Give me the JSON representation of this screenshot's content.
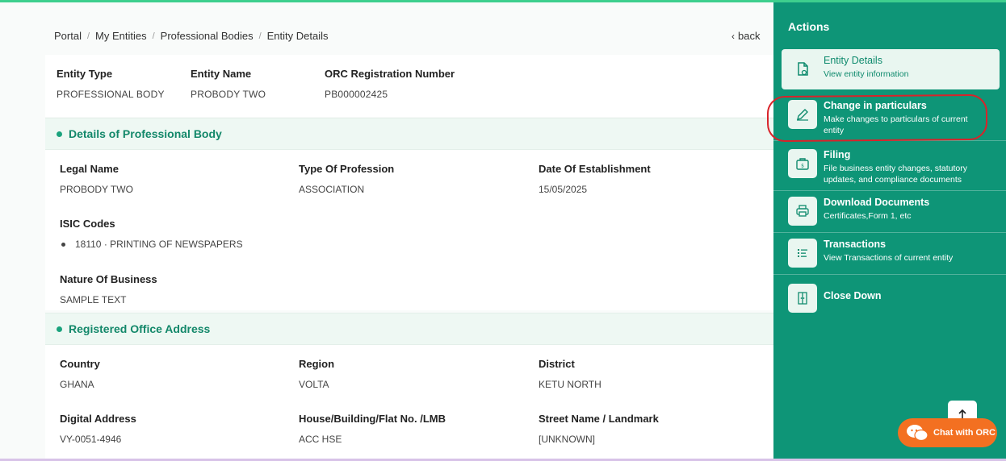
{
  "breadcrumb": [
    "Portal",
    "My Entities",
    "Professional Bodies",
    "Entity Details"
  ],
  "back_label": "back",
  "summary": [
    {
      "label": "Entity Type",
      "value": "PROFESSIONAL BODY"
    },
    {
      "label": "Entity Name",
      "value": "PROBODY TWO"
    },
    {
      "label": "ORC Registration Number",
      "value": "PB000002425"
    }
  ],
  "details_section": {
    "title": "Details of Professional Body",
    "legal_name": {
      "label": "Legal Name",
      "value": "PROBODY TWO"
    },
    "profession_type": {
      "label": "Type Of Profession",
      "value": "ASSOCIATION"
    },
    "establishment_date": {
      "label": "Date Of Establishment",
      "value": "15/05/2025"
    },
    "isic": {
      "label": "ISIC Codes",
      "items": [
        "18110 · PRINTING OF NEWSPAPERS"
      ]
    },
    "nature": {
      "label": "Nature Of Business",
      "value": "SAMPLE TEXT"
    }
  },
  "address_section": {
    "title": "Registered Office Address",
    "country": {
      "label": "Country",
      "value": "GHANA"
    },
    "region": {
      "label": "Region",
      "value": "VOLTA"
    },
    "district": {
      "label": "District",
      "value": "KETU NORTH"
    },
    "digital_address": {
      "label": "Digital Address",
      "value": "VY-0051-4946"
    },
    "house": {
      "label": "House/Building/Flat No. /LMB",
      "value": "ACC HSE"
    },
    "street": {
      "label": "Street Name / Landmark",
      "value": "[UNKNOWN]"
    }
  },
  "actions": {
    "title": "Actions",
    "items": [
      {
        "title": "Entity Details",
        "desc": "View entity information",
        "icon": "file-eye-icon"
      },
      {
        "title": "Change in particulars",
        "desc": "Make changes to particulars of current entity",
        "icon": "pencil-icon"
      },
      {
        "title": "Filing",
        "desc": "File business entity changes, statutory updates, and compliance documents",
        "icon": "briefcase-icon"
      },
      {
        "title": "Download Documents",
        "desc": "Certificates,Form 1, etc",
        "icon": "printer-icon"
      },
      {
        "title": "Transactions",
        "desc": "View Transactions of current entity",
        "icon": "list-icon"
      },
      {
        "title": "Close Down",
        "desc": "",
        "icon": "door-icon"
      }
    ]
  },
  "chat_label": "Chat with ORC",
  "colors": {
    "accent": "#0e9577",
    "section_title": "#13886a",
    "chat": "#f37021",
    "highlight": "#d8232a"
  }
}
